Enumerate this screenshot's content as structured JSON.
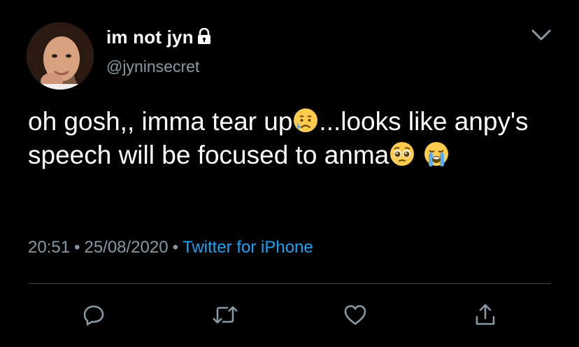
{
  "user": {
    "display_name": "im not jyn",
    "handle": "@jyninsecret",
    "protected": true
  },
  "tweet": {
    "text_part1": "oh gosh,, imma tear up",
    "emoji_1": "crying-face",
    "text_part2": "...looks like anpy's speech will be focused to anma",
    "emoji_2": "pleading-face",
    "emoji_3": "loudly-crying-face"
  },
  "meta": {
    "time": "20:51",
    "separator": "•",
    "date": "25/08/2020",
    "source": "Twitter for iPhone"
  },
  "actions": {
    "reply_icon": "reply-icon",
    "retweet_icon": "retweet-icon",
    "like_icon": "heart-icon",
    "share_icon": "share-icon"
  },
  "colors": {
    "background": "#000000",
    "text": "#ffffff",
    "secondary": "#8899a6",
    "link": "#1da1f2",
    "divider": "#38444d"
  }
}
